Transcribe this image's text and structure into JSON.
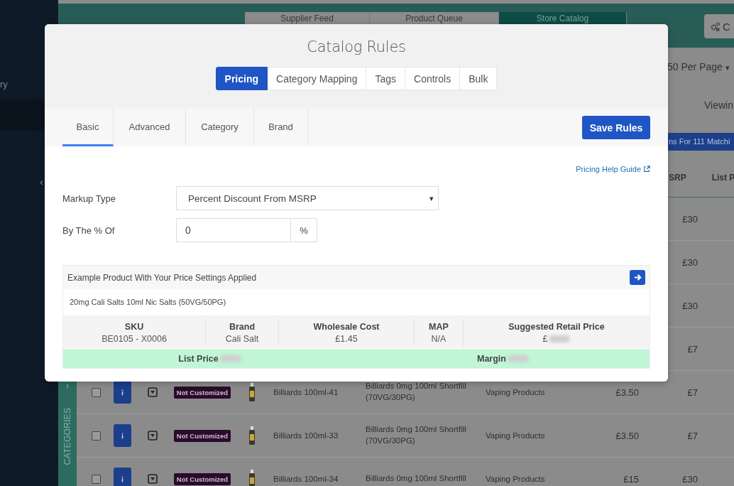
{
  "sidebar": {
    "items": [
      {
        "label": "ry",
        "selected": false
      },
      {
        "selected": true
      }
    ],
    "toggle": "‹"
  },
  "header_tabs": [
    {
      "label": "Supplier Feed",
      "selected": false
    },
    {
      "label": "Product Queue",
      "selected": false
    },
    {
      "label": "Store Catalog",
      "selected": true
    }
  ],
  "options_button": "C",
  "per_page": "50 Per Page",
  "per_page_caret": "▾",
  "viewing": "Viewin",
  "match_bar": "ns For 111 Matchi",
  "table": {
    "columns": [
      {
        "label": "SRP"
      },
      {
        "label": "List P"
      }
    ],
    "rows": [
      {
        "msrp": "£30"
      },
      {
        "msrp": "£30"
      },
      {
        "msrp": "£30"
      },
      {
        "msrp": "£7"
      },
      {
        "checked": false,
        "badge": "Not Customized",
        "name": "Billiards 100ml-41",
        "description": "Billiards 0mg 100ml Shortfill (70VG/30PG)",
        "category": "Vaping Products",
        "price": "£3.50",
        "msrp": "£7"
      },
      {
        "checked": false,
        "badge": "Not Customized",
        "name": "Billiards 100ml-33",
        "description": "Billiards 0mg 100ml Shortfill (70VG/30PG)",
        "category": "Vaping Products",
        "price": "£3.50",
        "msrp": "£7"
      },
      {
        "checked": false,
        "badge": "Not Customized",
        "name": "Billiards 100ml-34",
        "description": "Billiards 0mg 100ml Shortfill",
        "category": "Vaping Products",
        "price": "£15",
        "msrp": "£30"
      }
    ]
  },
  "categories_tab": {
    "arrow": "›",
    "label": "CATEGORIES"
  },
  "modal": {
    "title": "Catalog Rules",
    "tabs": [
      {
        "label": "Pricing",
        "selected": true
      },
      {
        "label": "Category Mapping",
        "selected": false
      },
      {
        "label": "Tags",
        "selected": false
      },
      {
        "label": "Controls",
        "selected": false
      },
      {
        "label": "Bulk",
        "selected": false
      }
    ],
    "subtabs": [
      {
        "label": "Basic",
        "selected": true
      },
      {
        "label": "Advanced",
        "selected": false
      },
      {
        "label": "Category",
        "selected": false
      },
      {
        "label": "Brand",
        "selected": false
      }
    ],
    "save_button": "Save Rules",
    "help_link": "Pricing Help Guide",
    "fields": [
      {
        "kind": "select",
        "label": "Markup Type",
        "value": "Percent Discount From MSRP",
        "caret": "▾"
      },
      {
        "kind": "input",
        "label": "By The % Of",
        "value": "0",
        "addon": "%"
      }
    ],
    "example": {
      "title": "Example Product With Your Price Settings Applied",
      "product": "20mg Cali Salts 10ml Nic Salts (50VG/50PG)",
      "columns": [
        {
          "label": "SKU",
          "value": "BE0105 - X0006",
          "redacted": false
        },
        {
          "label": "Brand",
          "value": "Cali Salt",
          "redacted": false
        },
        {
          "label": "Wholesale Cost",
          "value": "£1.45",
          "redacted": false
        },
        {
          "label": "MAP",
          "value": "N/A",
          "redacted": false
        },
        {
          "label": "Suggested Retail Price",
          "value": "£",
          "redacted": true
        }
      ],
      "summary": [
        {
          "label": "List Price",
          "redacted": true
        },
        {
          "label": "Margin",
          "redacted": true
        }
      ]
    }
  }
}
